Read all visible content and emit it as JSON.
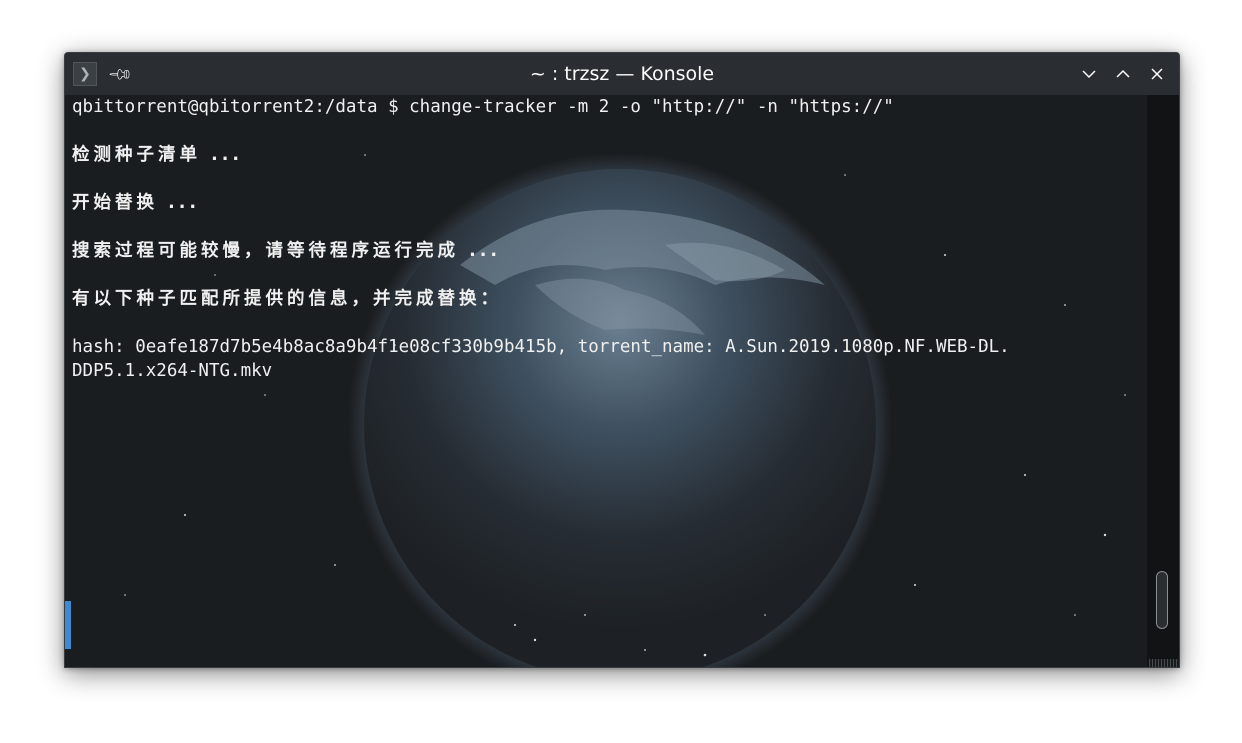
{
  "window": {
    "title": "~ : trzsz — Konsole",
    "app_icon": "terminal-prompt-icon",
    "pin_icon": "pin-icon",
    "controls": [
      "minimize-chevron-down-icon",
      "maximize-chevron-up-icon",
      "close-x-icon"
    ]
  },
  "terminal": {
    "lines": [
      "qbittorrent@qbitorrent2:/data $ change-tracker -m 2 -o \"http://\" -n \"https://\"",
      "检测种子清单 ...",
      "开始替换 ...",
      "搜索过程可能较慢，请等待程序运行完成 ...",
      "有以下种子匹配所提供的信息，并完成替换：",
      "hash: 0eafe187d7b5e4b8ac8a9b4f1e08cf330b9b415b, torrent_name: A.Sun.2019.1080p.NF.WEB-DL.",
      "DDP5.1.x264-NTG.mkv"
    ]
  },
  "colors": {
    "titlebar": "#2a2e32",
    "terminal_bg": "#1b1e20",
    "text": "#f0f0f0",
    "cursor": "#3d8ad1"
  }
}
